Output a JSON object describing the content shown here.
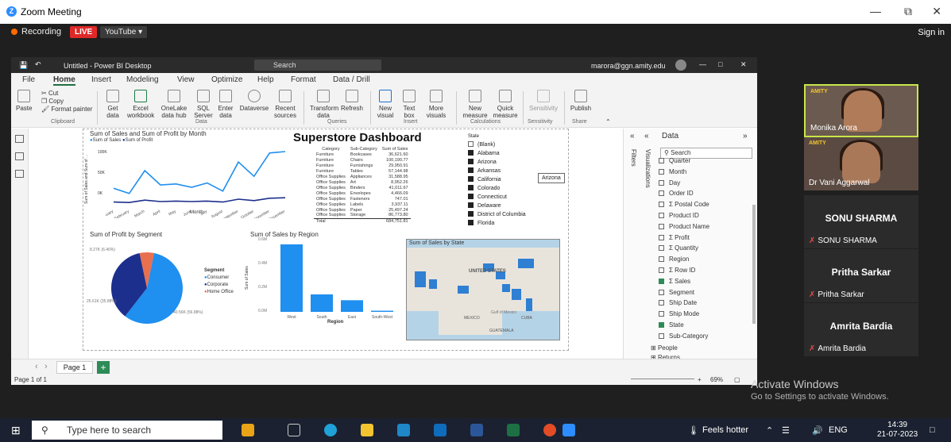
{
  "zoom": {
    "title": "Zoom Meeting",
    "recording": "Recording",
    "live": "LIVE",
    "youtube": "YouTube ▾",
    "signin": "Sign in"
  },
  "pbi": {
    "title": "Untitled - Power BI Desktop",
    "search": "Search",
    "user": "marora@ggn.amity.edu",
    "menu": [
      "File",
      "Home",
      "Insert",
      "Modeling",
      "View",
      "Optimize",
      "Help",
      "Format",
      "Data / Drill"
    ],
    "ribbon": {
      "paste": "Paste",
      "cut": "Cut",
      "copy": "Copy",
      "format_painter": "Format painter",
      "get_data": "Get data",
      "excel": "Excel workbook",
      "onelake": "OneLake data hub",
      "sql": "SQL Server",
      "enter": "Enter data",
      "dataverse": "Dataverse",
      "recent": "Recent sources",
      "transform": "Transform data",
      "refresh": "Refresh",
      "new_visual": "New visual",
      "text_box": "Text box",
      "more_visuals": "More visuals",
      "new_measure": "New measure",
      "quick_measure": "Quick measure",
      "sensitivity": "Sensitivity",
      "publish": "Publish",
      "groups": [
        "Clipboard",
        "Data",
        "Queries",
        "Insert",
        "Calculations",
        "Sensitivity",
        "Share"
      ]
    },
    "line_chart": {
      "title": "Sum of Sales and Sum of Profit by Month",
      "legend": [
        "Sum of Sales",
        "Sum of Profit"
      ],
      "xlabel": "Month",
      "ylabel": "Sum of Sales and Sum of ...",
      "yticks": [
        "100K",
        "50K",
        "0K"
      ]
    },
    "dashboard_title": "Superstore Dashboard",
    "table": {
      "headers": [
        "Category",
        "Sub-Category",
        "Sum of Sales"
      ],
      "rows": [
        [
          "Furniture",
          "Bookcases",
          "36,621.60"
        ],
        [
          "Furniture",
          "Chairs",
          "100,190.77"
        ],
        [
          "Furniture",
          "Furnishings",
          "29,950.91"
        ],
        [
          "Furniture",
          "Tables",
          "57,144.98"
        ],
        [
          "Office Supplies",
          "Appliances",
          "31,588.95"
        ],
        [
          "Office Supplies",
          "Art",
          "8,952.26"
        ],
        [
          "Office Supplies",
          "Binders",
          "41,011.67"
        ],
        [
          "Office Supplies",
          "Envelopes",
          "4,466.09"
        ],
        [
          "Office Supplies",
          "Fasteners",
          "747.01"
        ],
        [
          "Office Supplies",
          "Labels",
          "3,937.11"
        ],
        [
          "Office Supplies",
          "Paper",
          "25,497.24"
        ],
        [
          "Office Supplies",
          "Storage",
          "86,773.80"
        ]
      ],
      "total": [
        "Total",
        "",
        "684,751.81"
      ]
    },
    "slicer": {
      "title": "State",
      "items": [
        "(Blank)",
        "Alabama",
        "Arizona",
        "Arkansas",
        "California",
        "Colorado",
        "Connecticut",
        "Delaware",
        "District of Columbia",
        "Florida"
      ],
      "tooltip": "Arizona"
    },
    "pie": {
      "title": "Sum of Profit by Segment",
      "legend_title": "Segment",
      "legend": [
        "Consumer",
        "Corporate",
        "Home Office"
      ],
      "labels": [
        "8.27K (6.46%)",
        "40.56K (56.88%)",
        "25.61K (35.88%)"
      ]
    },
    "bar": {
      "title": "Sum of Sales by Region",
      "xlabel": "Region",
      "ylabel": "Sum of Sales",
      "yticks": [
        "0.6M",
        "0.4M",
        "0.2M",
        "0.0M"
      ],
      "categories": [
        "West",
        "South",
        "East",
        "South-West"
      ]
    },
    "map": {
      "title": "Sum of Sales by State",
      "country": "UNITED STATES",
      "mexico": "MEXICO",
      "gulf": "Gulf of Mexico",
      "cuba": "CUBA",
      "guatemala": "GUATEMALA"
    },
    "right": {
      "visualizations": "Visualizations",
      "filters": "Filters",
      "data": "Data",
      "search": "Search",
      "fields": [
        {
          "l": "Quarter",
          "c": false
        },
        {
          "l": "Month",
          "c": false
        },
        {
          "l": "Day",
          "c": false
        },
        {
          "l": "Order ID",
          "c": false
        },
        {
          "l": "Σ Postal Code",
          "c": false
        },
        {
          "l": "Product ID",
          "c": false
        },
        {
          "l": "Product Name",
          "c": false
        },
        {
          "l": "Σ Profit",
          "c": false
        },
        {
          "l": "Σ Quantity",
          "c": false
        },
        {
          "l": "Region",
          "c": false
        },
        {
          "l": "Σ Row ID",
          "c": false
        },
        {
          "l": "Σ Sales",
          "c": true
        },
        {
          "l": "Segment",
          "c": false
        },
        {
          "l": "Ship Date",
          "c": false
        },
        {
          "l": "Ship Mode",
          "c": false
        },
        {
          "l": "State",
          "c": true
        },
        {
          "l": "Sub-Category",
          "c": false
        }
      ],
      "tables": [
        "People",
        "Returns"
      ]
    },
    "page_tab": "Page 1",
    "page_status": "Page 1 of 1",
    "zoom": "69%"
  },
  "participants": [
    "Monika Arora",
    "Dr Vani Aggarwal",
    "SONU SHARMA",
    "Pritha Sarkar",
    "Amrita Bardia"
  ],
  "activate": {
    "l1": "Activate Windows",
    "l2": "Go to Settings to activate Windows."
  },
  "taskbar": {
    "search": "Type here to search",
    "weather": "Feels hotter",
    "lang": "ENG",
    "time": "14:39",
    "date": "21-07-2023"
  },
  "chart_data": [
    {
      "type": "line",
      "title": "Sum of Sales and Sum of Profit by Month",
      "xlabel": "Month",
      "ylabel": "Sum of Sales and Sum of ...",
      "x": [
        "January",
        "February",
        "March",
        "April",
        "May",
        "June",
        "July",
        "August",
        "September",
        "October",
        "November",
        "December"
      ],
      "series": [
        {
          "name": "Sum of Sales",
          "values": [
            33,
            22,
            70,
            40,
            42,
            35,
            44,
            27,
            88,
            58,
            107,
            110
          ]
        },
        {
          "name": "Sum of Profit",
          "values": [
            4,
            3,
            8,
            5,
            6,
            5,
            6,
            4,
            10,
            7,
            12,
            13
          ]
        }
      ],
      "ylim": [
        0,
        120
      ]
    },
    {
      "type": "pie",
      "title": "Sum of Profit by Segment",
      "categories": [
        "Consumer",
        "Corporate",
        "Home Office"
      ],
      "values": [
        56.88,
        35.88,
        6.46
      ]
    },
    {
      "type": "bar",
      "title": "Sum of Sales by Region",
      "xlabel": "Region",
      "ylabel": "Sum of Sales",
      "categories": [
        "West",
        "South",
        "East",
        "South-West"
      ],
      "values": [
        0.58,
        0.15,
        0.1,
        0.01
      ],
      "ylim": [
        0,
        0.6
      ]
    }
  ],
  "colors": {
    "sales": "#1f8ff0",
    "profit": "#1d2f8c",
    "consumer": "#1f8ff0",
    "corporate": "#1d2f8c",
    "home_office": "#e8704e"
  }
}
